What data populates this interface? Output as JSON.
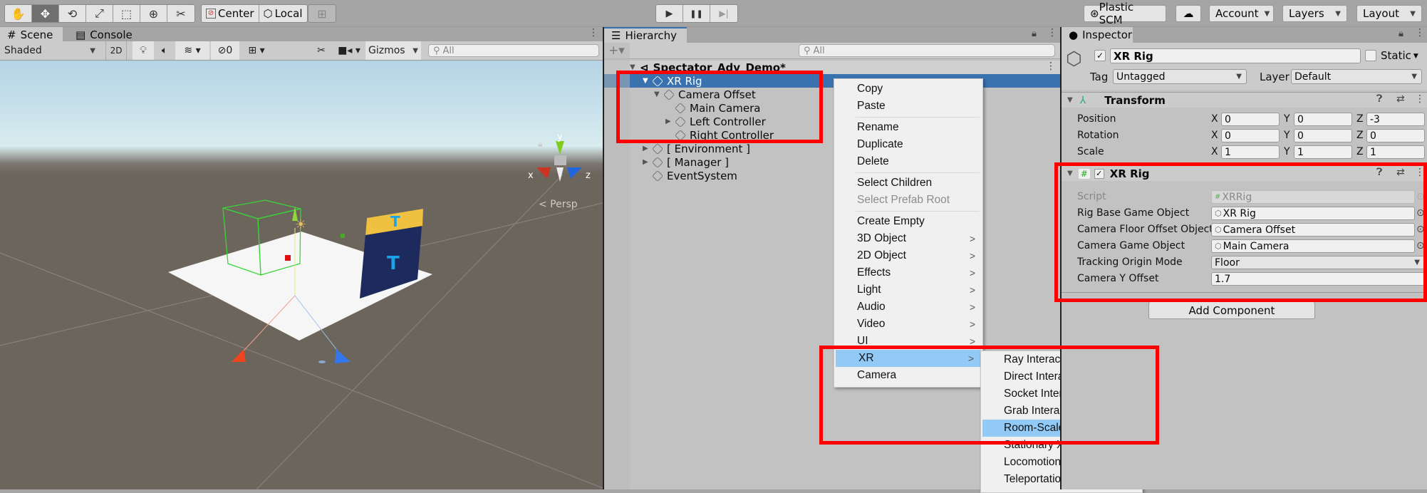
{
  "toolbar": {
    "tools": [
      {
        "name": "hand-tool",
        "glyph": "✋"
      },
      {
        "name": "move-tool",
        "glyph": "✥"
      },
      {
        "name": "rotate-tool",
        "glyph": "⟲"
      },
      {
        "name": "scale-tool",
        "glyph": "⤢"
      },
      {
        "name": "rect-tool",
        "glyph": "⬚"
      },
      {
        "name": "transform-tool",
        "glyph": "⊕"
      },
      {
        "name": "custom-tool",
        "glyph": "✂"
      }
    ],
    "pivot_label": "Center",
    "space_label": "Local",
    "play_glyph": "▶",
    "pause_glyph": "❚❚",
    "step_glyph": "▶|",
    "plastic_label": "Plastic SCM",
    "cloud_glyph": "☁",
    "account_label": "Account",
    "layers_label": "Layers",
    "layout_label": "Layout"
  },
  "scene_panel": {
    "tabs": [
      {
        "label": "Scene",
        "glyph": "#"
      },
      {
        "label": "Console",
        "glyph": "▤"
      }
    ],
    "shading_mode": "Shaded",
    "mode_2d": "2D",
    "hidden_count": "0",
    "gizmos_label": "Gizmos",
    "search_placeholder": "All",
    "persp_label": "< Persp",
    "axis_labels": {
      "x": "x",
      "y": "y",
      "z": "z"
    }
  },
  "hierarchy": {
    "tab_label": "Hierarchy",
    "add_label": "+▾",
    "search_placeholder": "All",
    "scene_name": "Spectator_Adv_Demo*",
    "items": [
      {
        "label": "XR Rig",
        "depth": 1,
        "expand": "▼",
        "selected": true
      },
      {
        "label": "Camera Offset",
        "depth": 2,
        "expand": "▼"
      },
      {
        "label": "Main Camera",
        "depth": 3,
        "expand": ""
      },
      {
        "label": "Left Controller",
        "depth": 3,
        "expand": "▶"
      },
      {
        "label": "Right Controller",
        "depth": 3,
        "expand": ""
      },
      {
        "label": "[ Environment ]",
        "depth": 1,
        "expand": "▶"
      },
      {
        "label": "[ Manager ]",
        "depth": 1,
        "expand": "▶"
      },
      {
        "label": "EventSystem",
        "depth": 1,
        "expand": ""
      }
    ]
  },
  "context_menu": {
    "items": [
      {
        "label": "Copy"
      },
      {
        "label": "Paste"
      },
      {
        "label": "Rename"
      },
      {
        "label": "Duplicate"
      },
      {
        "label": "Delete"
      },
      {
        "label": "Select Children"
      },
      {
        "label": "Select Prefab Root",
        "disabled": true
      },
      {
        "label": "Create Empty"
      },
      {
        "label": "3D Object",
        "submenu": true
      },
      {
        "label": "2D Object",
        "submenu": true
      },
      {
        "label": "Effects",
        "submenu": true
      },
      {
        "label": "Light",
        "submenu": true
      },
      {
        "label": "Audio",
        "submenu": true
      },
      {
        "label": "Video",
        "submenu": true
      },
      {
        "label": "UI",
        "submenu": true
      },
      {
        "label": "XR",
        "submenu": true,
        "highlighted": true
      },
      {
        "label": "Camera"
      }
    ],
    "arrow_glyph": ">"
  },
  "xr_submenu": {
    "items": [
      {
        "label": "Ray Interactor"
      },
      {
        "label": "Direct Interactor"
      },
      {
        "label": "Socket Interactor"
      },
      {
        "label": "Grab Interactable"
      },
      {
        "label": "Room-Scale XR Rig",
        "highlighted": true
      },
      {
        "label": "Stationary XR Rig"
      },
      {
        "label": "Locomotion System"
      },
      {
        "label": "Teleportation Area"
      }
    ]
  },
  "inspector": {
    "tab_label": "Inspector",
    "object_name": "XR Rig",
    "active": true,
    "static_label": "Static",
    "tag_label": "Tag",
    "tag_value": "Untagged",
    "layer_label": "Layer",
    "layer_value": "Default",
    "transform": {
      "title": "Transform",
      "rows": [
        {
          "label": "Position",
          "x": "0",
          "y": "0",
          "z": "-3"
        },
        {
          "label": "Rotation",
          "x": "0",
          "y": "0",
          "z": "0"
        },
        {
          "label": "Scale",
          "x": "1",
          "y": "1",
          "z": "1"
        }
      ]
    },
    "xr_rig": {
      "title": "XR Rig",
      "enabled": true,
      "script_label": "Script",
      "script_value": "XRRig",
      "fields": [
        {
          "label": "Rig Base Game Object",
          "value": "XR Rig",
          "type": "object"
        },
        {
          "label": "Camera Floor Offset Object",
          "value": "Camera Offset",
          "type": "object"
        },
        {
          "label": "Camera Game Object",
          "value": "Main Camera",
          "type": "object"
        },
        {
          "label": "Tracking Origin Mode",
          "value": "Floor",
          "type": "dropdown"
        },
        {
          "label": "Camera Y Offset",
          "value": "1.7",
          "type": "text"
        }
      ]
    },
    "add_component_label": "Add Component"
  },
  "colors": {
    "selection_blue": "#3a72b0",
    "menu_highlight": "#91c9f7",
    "annotation_red": "#ff0000"
  }
}
